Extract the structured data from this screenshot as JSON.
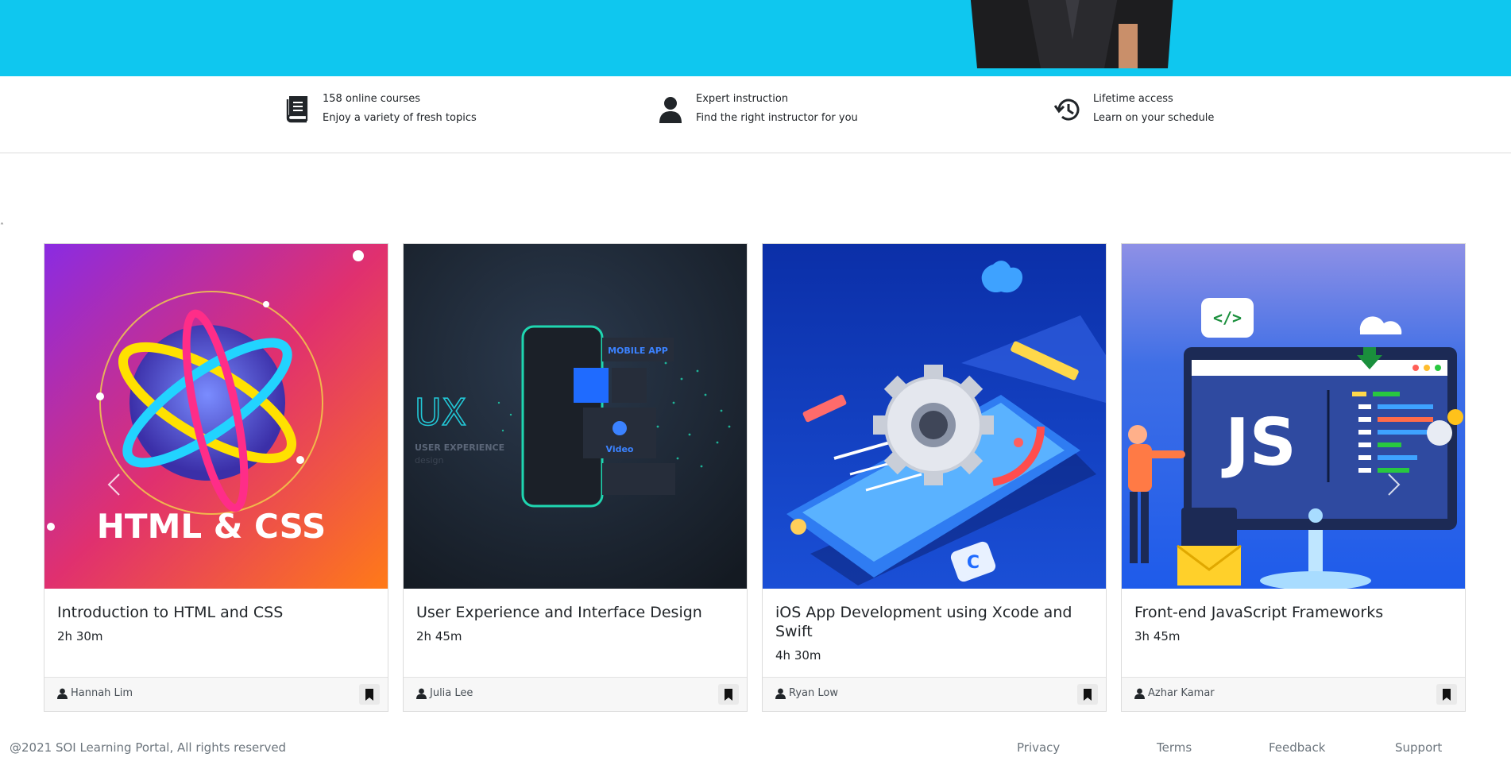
{
  "features": [
    {
      "icon": "book-icon",
      "line1": "158 online courses",
      "line2": "Enjoy a variety of fresh topics"
    },
    {
      "icon": "person-icon",
      "line1": "Expert instruction",
      "line2": "Find the right instructor for you"
    },
    {
      "icon": "history-icon",
      "line1": "Lifetime access",
      "line2": "Learn on your schedule"
    }
  ],
  "courses": [
    {
      "title": "Introduction to HTML and CSS",
      "duration": "2h 30m",
      "author": "Hannah Lim",
      "thumb_text": "HTML & CSS"
    },
    {
      "title": "User Experience and Interface Design",
      "duration": "2h 45m",
      "author": "Julia Lee",
      "thumb_text": "UX",
      "thumb_sub": "USER EXPERIENCE",
      "thumb_sub2": "design",
      "thumb_badge": "MOBILE APP",
      "thumb_video": "Video"
    },
    {
      "title": "iOS App Development using Xcode and Swift",
      "duration": "4h 30m",
      "author": "Ryan Low"
    },
    {
      "title": "Front-end JavaScript Frameworks",
      "duration": "3h 45m",
      "author": "Azhar Kamar",
      "thumb_text": "JS",
      "thumb_code": "</>"
    }
  ],
  "footer": {
    "copyright": "@2021 SOI Learning Portal, All rights reserved",
    "links": [
      "Privacy",
      "Terms",
      "Feedback",
      "Support"
    ]
  },
  "colors": {
    "hero": "#0fc7ef",
    "footer_text": "#6c757d"
  }
}
